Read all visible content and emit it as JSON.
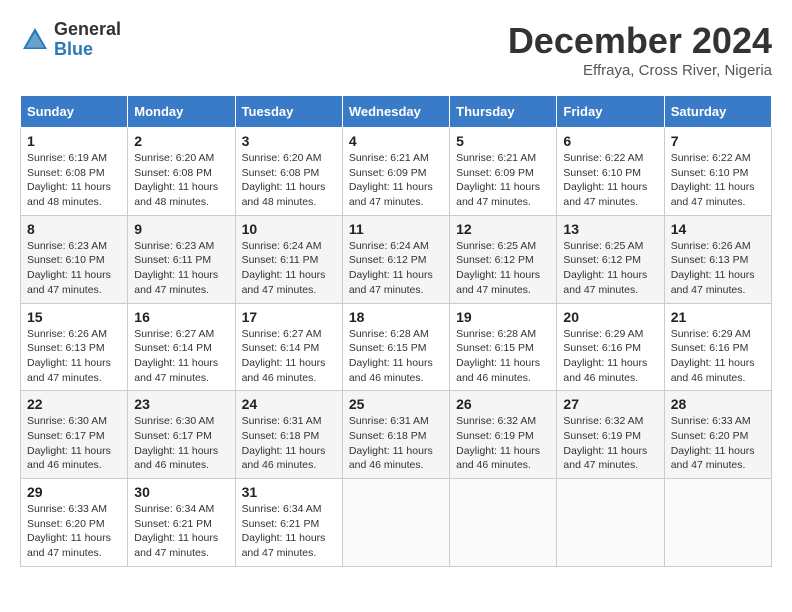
{
  "header": {
    "logo_general": "General",
    "logo_blue": "Blue",
    "month_title": "December 2024",
    "location": "Effraya, Cross River, Nigeria"
  },
  "days_of_week": [
    "Sunday",
    "Monday",
    "Tuesday",
    "Wednesday",
    "Thursday",
    "Friday",
    "Saturday"
  ],
  "weeks": [
    [
      {
        "day": "1",
        "info": "Sunrise: 6:19 AM\nSunset: 6:08 PM\nDaylight: 11 hours and 48 minutes."
      },
      {
        "day": "2",
        "info": "Sunrise: 6:20 AM\nSunset: 6:08 PM\nDaylight: 11 hours and 48 minutes."
      },
      {
        "day": "3",
        "info": "Sunrise: 6:20 AM\nSunset: 6:08 PM\nDaylight: 11 hours and 48 minutes."
      },
      {
        "day": "4",
        "info": "Sunrise: 6:21 AM\nSunset: 6:09 PM\nDaylight: 11 hours and 47 minutes."
      },
      {
        "day": "5",
        "info": "Sunrise: 6:21 AM\nSunset: 6:09 PM\nDaylight: 11 hours and 47 minutes."
      },
      {
        "day": "6",
        "info": "Sunrise: 6:22 AM\nSunset: 6:10 PM\nDaylight: 11 hours and 47 minutes."
      },
      {
        "day": "7",
        "info": "Sunrise: 6:22 AM\nSunset: 6:10 PM\nDaylight: 11 hours and 47 minutes."
      }
    ],
    [
      {
        "day": "8",
        "info": "Sunrise: 6:23 AM\nSunset: 6:10 PM\nDaylight: 11 hours and 47 minutes."
      },
      {
        "day": "9",
        "info": "Sunrise: 6:23 AM\nSunset: 6:11 PM\nDaylight: 11 hours and 47 minutes."
      },
      {
        "day": "10",
        "info": "Sunrise: 6:24 AM\nSunset: 6:11 PM\nDaylight: 11 hours and 47 minutes."
      },
      {
        "day": "11",
        "info": "Sunrise: 6:24 AM\nSunset: 6:12 PM\nDaylight: 11 hours and 47 minutes."
      },
      {
        "day": "12",
        "info": "Sunrise: 6:25 AM\nSunset: 6:12 PM\nDaylight: 11 hours and 47 minutes."
      },
      {
        "day": "13",
        "info": "Sunrise: 6:25 AM\nSunset: 6:12 PM\nDaylight: 11 hours and 47 minutes."
      },
      {
        "day": "14",
        "info": "Sunrise: 6:26 AM\nSunset: 6:13 PM\nDaylight: 11 hours and 47 minutes."
      }
    ],
    [
      {
        "day": "15",
        "info": "Sunrise: 6:26 AM\nSunset: 6:13 PM\nDaylight: 11 hours and 47 minutes."
      },
      {
        "day": "16",
        "info": "Sunrise: 6:27 AM\nSunset: 6:14 PM\nDaylight: 11 hours and 47 minutes."
      },
      {
        "day": "17",
        "info": "Sunrise: 6:27 AM\nSunset: 6:14 PM\nDaylight: 11 hours and 46 minutes."
      },
      {
        "day": "18",
        "info": "Sunrise: 6:28 AM\nSunset: 6:15 PM\nDaylight: 11 hours and 46 minutes."
      },
      {
        "day": "19",
        "info": "Sunrise: 6:28 AM\nSunset: 6:15 PM\nDaylight: 11 hours and 46 minutes."
      },
      {
        "day": "20",
        "info": "Sunrise: 6:29 AM\nSunset: 6:16 PM\nDaylight: 11 hours and 46 minutes."
      },
      {
        "day": "21",
        "info": "Sunrise: 6:29 AM\nSunset: 6:16 PM\nDaylight: 11 hours and 46 minutes."
      }
    ],
    [
      {
        "day": "22",
        "info": "Sunrise: 6:30 AM\nSunset: 6:17 PM\nDaylight: 11 hours and 46 minutes."
      },
      {
        "day": "23",
        "info": "Sunrise: 6:30 AM\nSunset: 6:17 PM\nDaylight: 11 hours and 46 minutes."
      },
      {
        "day": "24",
        "info": "Sunrise: 6:31 AM\nSunset: 6:18 PM\nDaylight: 11 hours and 46 minutes."
      },
      {
        "day": "25",
        "info": "Sunrise: 6:31 AM\nSunset: 6:18 PM\nDaylight: 11 hours and 46 minutes."
      },
      {
        "day": "26",
        "info": "Sunrise: 6:32 AM\nSunset: 6:19 PM\nDaylight: 11 hours and 46 minutes."
      },
      {
        "day": "27",
        "info": "Sunrise: 6:32 AM\nSunset: 6:19 PM\nDaylight: 11 hours and 47 minutes."
      },
      {
        "day": "28",
        "info": "Sunrise: 6:33 AM\nSunset: 6:20 PM\nDaylight: 11 hours and 47 minutes."
      }
    ],
    [
      {
        "day": "29",
        "info": "Sunrise: 6:33 AM\nSunset: 6:20 PM\nDaylight: 11 hours and 47 minutes."
      },
      {
        "day": "30",
        "info": "Sunrise: 6:34 AM\nSunset: 6:21 PM\nDaylight: 11 hours and 47 minutes."
      },
      {
        "day": "31",
        "info": "Sunrise: 6:34 AM\nSunset: 6:21 PM\nDaylight: 11 hours and 47 minutes."
      },
      null,
      null,
      null,
      null
    ]
  ]
}
